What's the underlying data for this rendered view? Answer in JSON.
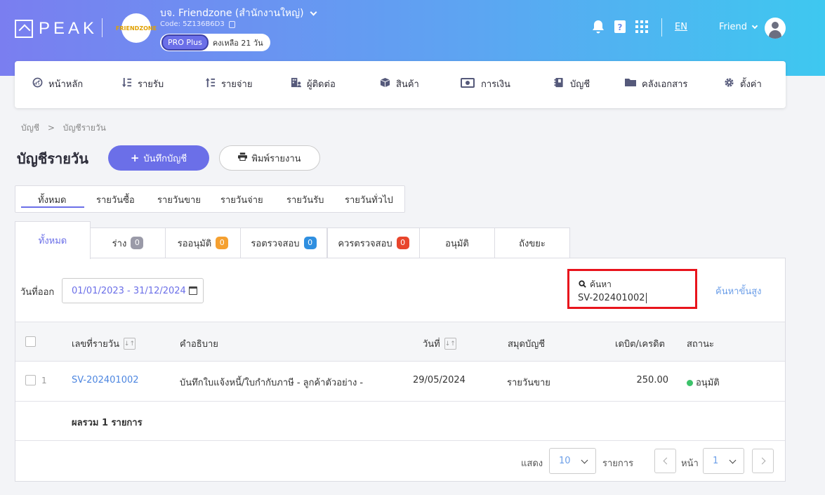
{
  "header": {
    "logo_text": "PEAK",
    "company_name": "บจ. Friendzone (สำนักงานใหญ่)",
    "company_code": "Code: 5Z136B6D3",
    "company_avatar_text": "FRIENDZONE",
    "plan_label": "PRO Plus",
    "plan_days": "คงเหลือ 21 วัน",
    "language": "EN",
    "user_name": "Friend",
    "colors": {
      "gradient_start": "#7a7ef0",
      "gradient_end": "#3ec8f0"
    }
  },
  "nav": {
    "items": [
      {
        "label": "หน้าหลัก",
        "icon": "dashboard-icon"
      },
      {
        "label": "รายรับ",
        "icon": "income-icon"
      },
      {
        "label": "รายจ่าย",
        "icon": "expense-icon"
      },
      {
        "label": "ผู้ติดต่อ",
        "icon": "contacts-icon"
      },
      {
        "label": "สินค้า",
        "icon": "box-icon"
      },
      {
        "label": "การเงิน",
        "icon": "money-icon"
      },
      {
        "label": "บัญชี",
        "icon": "ledger-icon"
      },
      {
        "label": "คลังเอกสาร",
        "icon": "folder-icon"
      },
      {
        "label": "ตั้งค่า",
        "icon": "gear-icon"
      }
    ]
  },
  "breadcrumb": {
    "root": "บัญชี",
    "separator": ">",
    "current": "บัญชีรายวัน"
  },
  "page": {
    "title": "บัญชีรายวัน",
    "record_button": "บันทึกบัญชี",
    "print_button": "พิมพ์รายงาน"
  },
  "journal_tabs": [
    "ทั้งหมด",
    "รายวันซื้อ",
    "รายวันขาย",
    "รายวันจ่าย",
    "รายวันรับ",
    "รายวันทั่วไป"
  ],
  "status_tabs": [
    {
      "label": "ทั้งหมด",
      "count": null
    },
    {
      "label": "ร่าง",
      "count": "0",
      "color": "#9a9aa8"
    },
    {
      "label": "รออนุมัติ",
      "count": "0",
      "color": "#f5a030"
    },
    {
      "label": "รอตรวจสอบ",
      "count": "0",
      "color": "#2f8fe0"
    },
    {
      "label": "ควรตรวจสอบ",
      "count": "0",
      "color": "#e8452c"
    },
    {
      "label": "อนุมัติ",
      "count": null
    },
    {
      "label": "ถังขยะ",
      "count": null
    }
  ],
  "filters": {
    "date_label": "วันที่ออก",
    "date_range": "01/01/2023 - 31/12/2024",
    "search_label": "ค้นหา",
    "search_value": "SV-202401002",
    "advanced_search": "ค้นหาขั้นสูง"
  },
  "table": {
    "headers": {
      "number": "เลขที่รายวัน",
      "description": "คำอธิบาย",
      "date": "วันที่",
      "journal": "สมุดบัญชี",
      "amount": "เดบิต/เครดิต",
      "status": "สถานะ"
    },
    "rows": [
      {
        "index": "1",
        "number": "SV-202401002",
        "description": "บันทึกใบแจ้งหนี้/ใบกำกับภาษี - ลูกค้าตัวอย่าง -",
        "date": "29/05/2024",
        "journal": "รายวันขาย",
        "amount": "250.00",
        "status": "อนุมัติ"
      }
    ],
    "summary": "ผลรวม 1 รายการ"
  },
  "pager": {
    "show_label": "แสดง",
    "page_size": "10",
    "items_label": "รายการ",
    "page_label": "หน้า",
    "page": "1"
  }
}
